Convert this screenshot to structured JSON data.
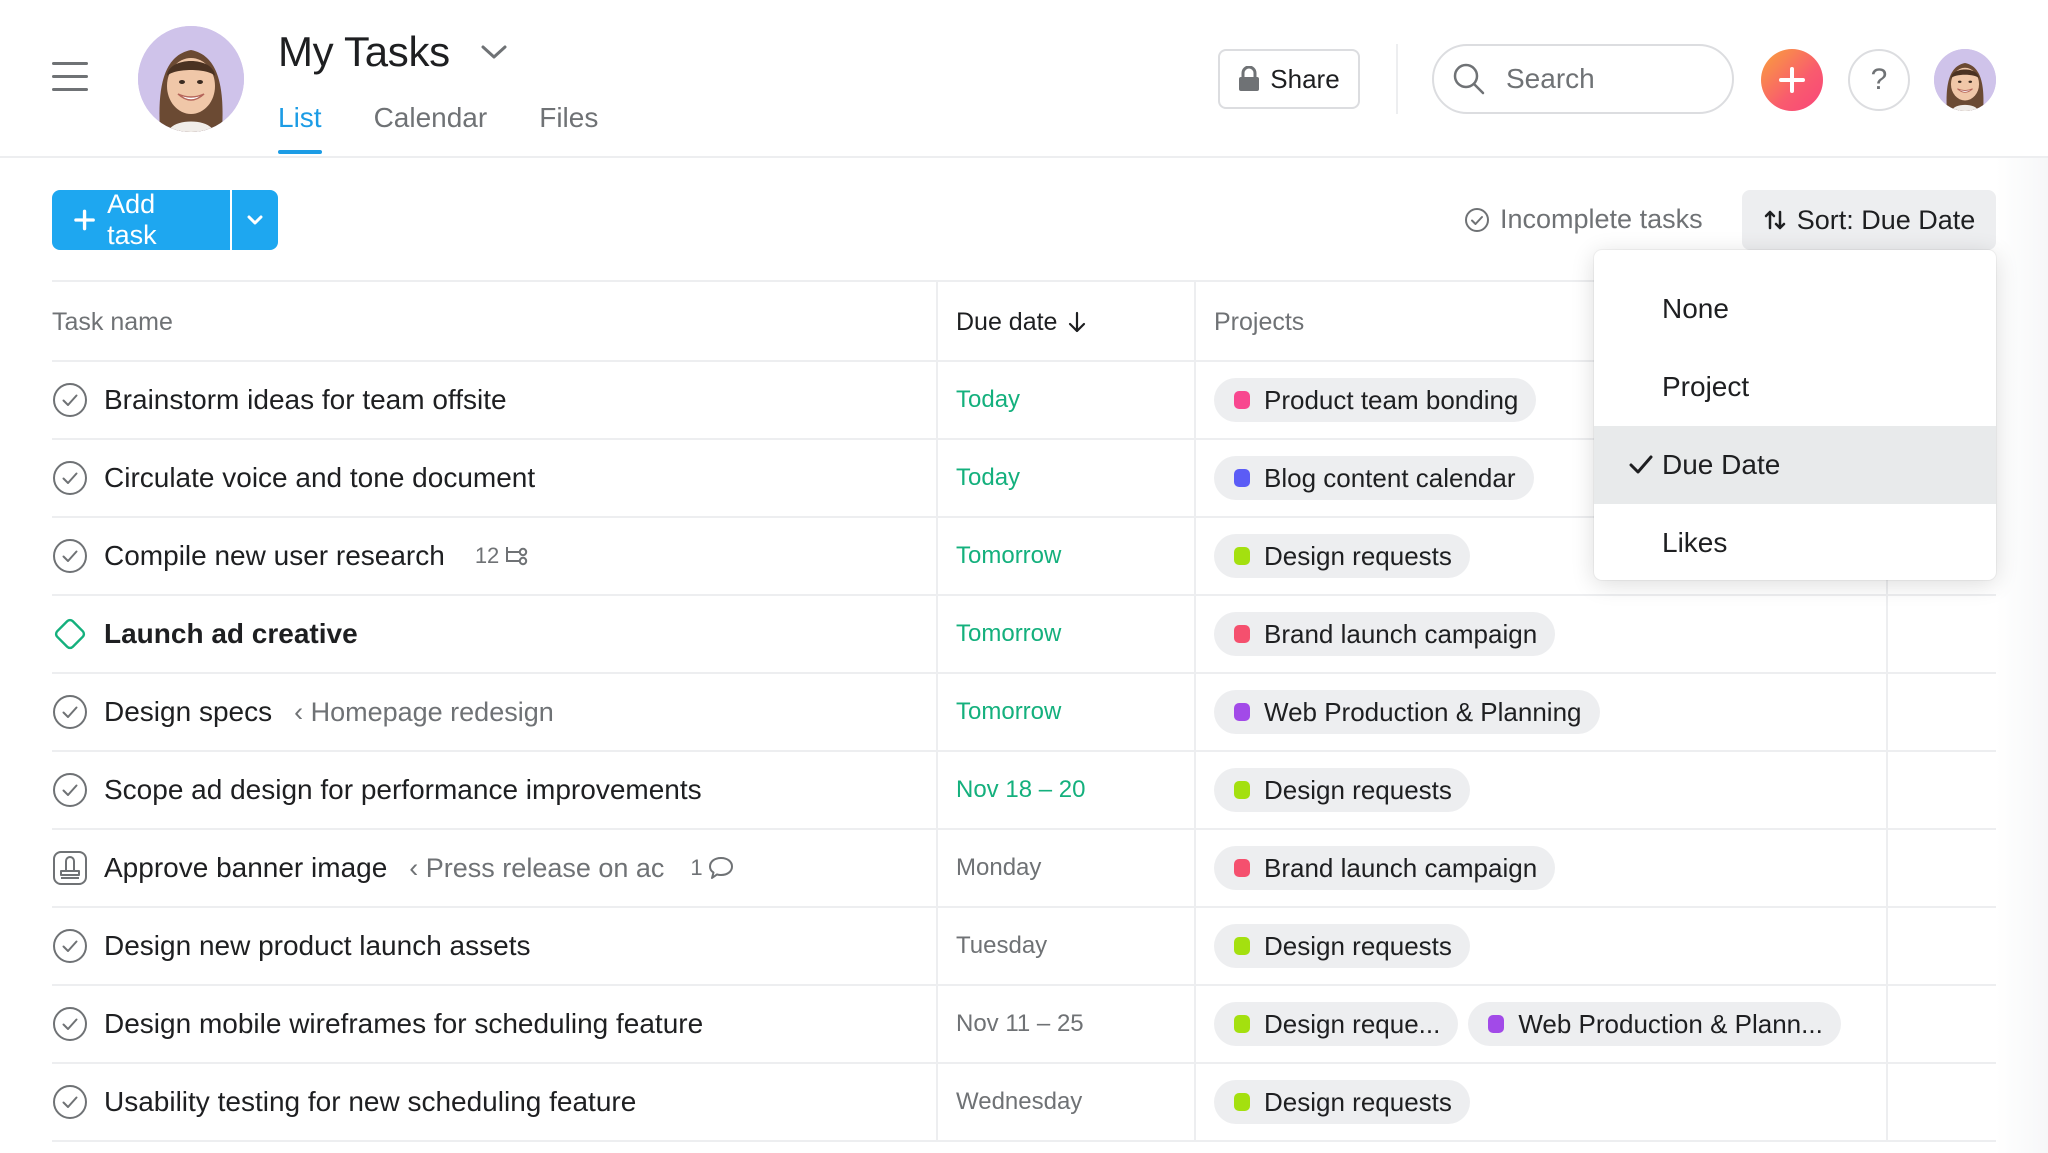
{
  "header": {
    "title": "My Tasks",
    "tabs": [
      {
        "label": "List",
        "active": true
      },
      {
        "label": "Calendar",
        "active": false
      },
      {
        "label": "Files",
        "active": false
      }
    ],
    "share_label": "Share",
    "search_placeholder": "Search",
    "help_label": "?"
  },
  "toolbar": {
    "add_task_label": "Add task",
    "incomplete_label": "Incomplete tasks",
    "sort_label": "Sort: Due Date"
  },
  "sort_menu": {
    "options": [
      "None",
      "Project",
      "Due Date",
      "Likes"
    ],
    "selected": "Due Date"
  },
  "table": {
    "columns": {
      "name": "Task name",
      "due": "Due date",
      "projects": "Projects"
    },
    "rows": [
      {
        "name": "Brainstorm ideas for team offsite",
        "icon": "check-circle-icon",
        "due": "Today",
        "due_color": "green",
        "projects": [
          {
            "label": "Product team bonding",
            "color": "#f8478f"
          }
        ]
      },
      {
        "name": "Circulate voice and tone document",
        "icon": "check-circle-icon",
        "due": "Today",
        "due_color": "green",
        "projects": [
          {
            "label": "Blog content calendar",
            "color": "#5b5cf6"
          }
        ]
      },
      {
        "name": "Compile new user research",
        "icon": "check-circle-icon",
        "subtask_count": "12",
        "due": "Tomorrow",
        "due_color": "green",
        "projects": [
          {
            "label": "Design requests",
            "color": "#a4e00f"
          }
        ]
      },
      {
        "name": "Launch ad creative",
        "icon": "milestone-icon",
        "bold": true,
        "due": "Tomorrow",
        "due_color": "green",
        "projects": [
          {
            "label": "Brand launch campaign",
            "color": "#f5506e"
          }
        ]
      },
      {
        "name": "Design specs",
        "icon": "check-circle-icon",
        "parent": "‹ Homepage redesign",
        "due": "Tomorrow",
        "due_color": "green",
        "projects": [
          {
            "label": "Web Production & Planning",
            "color": "#a24ae8"
          }
        ]
      },
      {
        "name": "Scope ad design for performance improvements",
        "icon": "check-circle-icon",
        "due": "Nov 18 – 20",
        "due_color": "green",
        "projects": [
          {
            "label": "Design requests",
            "color": "#a4e00f"
          }
        ]
      },
      {
        "name": "Approve banner image",
        "icon": "approval-icon",
        "parent": "‹ Press release on ac",
        "comment_count": "1",
        "due": "Monday",
        "due_color": "gray",
        "projects": [
          {
            "label": "Brand launch campaign",
            "color": "#f5506e"
          }
        ]
      },
      {
        "name": "Design new product launch assets",
        "icon": "check-circle-icon",
        "due": "Tuesday",
        "due_color": "gray",
        "projects": [
          {
            "label": "Design requests",
            "color": "#a4e00f"
          }
        ]
      },
      {
        "name": "Design mobile wireframes for scheduling feature",
        "icon": "check-circle-icon",
        "due": "Nov 11 – 25",
        "due_color": "gray",
        "projects": [
          {
            "label": "Design reque...",
            "color": "#a4e00f"
          },
          {
            "label": "Web Production & Plann...",
            "color": "#a24ae8"
          }
        ]
      },
      {
        "name": "Usability testing for new scheduling feature",
        "icon": "check-circle-icon",
        "due": "Wednesday",
        "due_color": "gray",
        "projects": [
          {
            "label": "Design requests",
            "color": "#a4e00f"
          }
        ]
      }
    ]
  }
}
